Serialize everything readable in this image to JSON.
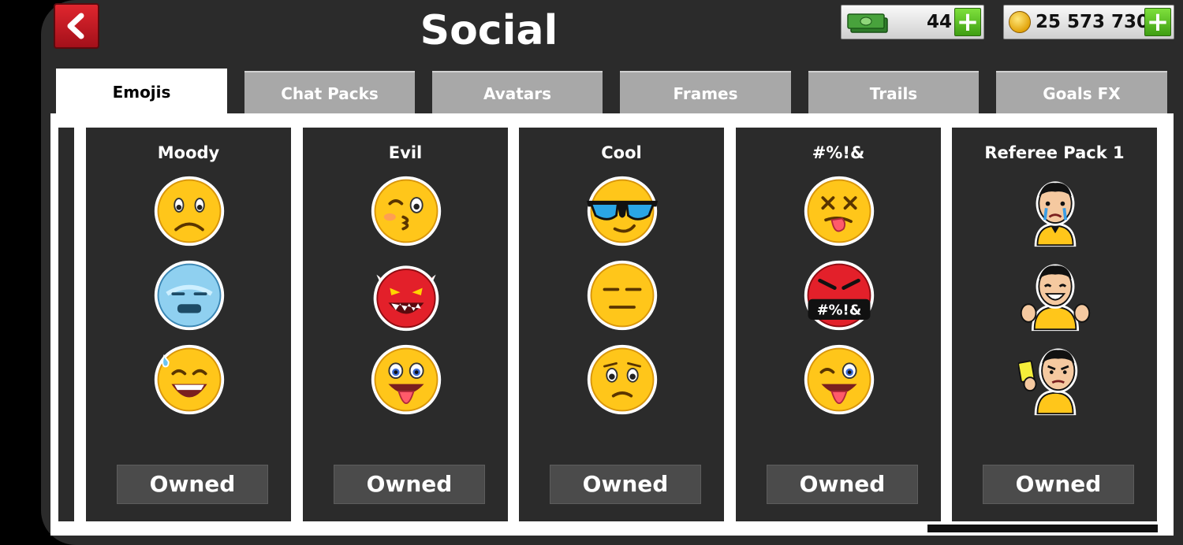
{
  "header": {
    "title": "Social"
  },
  "currency": {
    "cash": {
      "value": "44",
      "icon": "cash-icon"
    },
    "coins": {
      "value": "25 573 730",
      "icon": "coin-icon"
    }
  },
  "tabs": [
    {
      "label": "Emojis",
      "active": true
    },
    {
      "label": "Chat Packs",
      "active": false
    },
    {
      "label": "Avatars",
      "active": false
    },
    {
      "label": "Frames",
      "active": false
    },
    {
      "label": "Trails",
      "active": false
    },
    {
      "label": "Goals FX",
      "active": false
    }
  ],
  "packs": [
    {
      "title": "Moody",
      "status": "Owned",
      "emojis": [
        "frown-face",
        "freezing-face",
        "sweat-grin-face"
      ]
    },
    {
      "title": "Evil",
      "status": "Owned",
      "emojis": [
        "kiss-wink-face",
        "red-devil-face",
        "tongue-out-face"
      ]
    },
    {
      "title": "Cool",
      "status": "Owned",
      "emojis": [
        "sunglasses-face",
        "expressionless-face",
        "worried-face"
      ]
    },
    {
      "title": "#%!&",
      "status": "Owned",
      "emojis": [
        "dizzy-tongue-face",
        "cursing-face",
        "wink-tongue-face"
      ]
    },
    {
      "title": "Referee Pack 1",
      "status": "Owned",
      "emojis": [
        "crying-referee",
        "thumbs-up-referee",
        "yellow-card-referee"
      ]
    }
  ],
  "cursing_badge": "#%!&",
  "scroll": {
    "position": 1.0
  },
  "colors": {
    "back_button": "#c8141e",
    "plus_button": "#5bc426",
    "card_bg": "#2b2b2b",
    "inactive_tab": "#a8a8a8"
  }
}
